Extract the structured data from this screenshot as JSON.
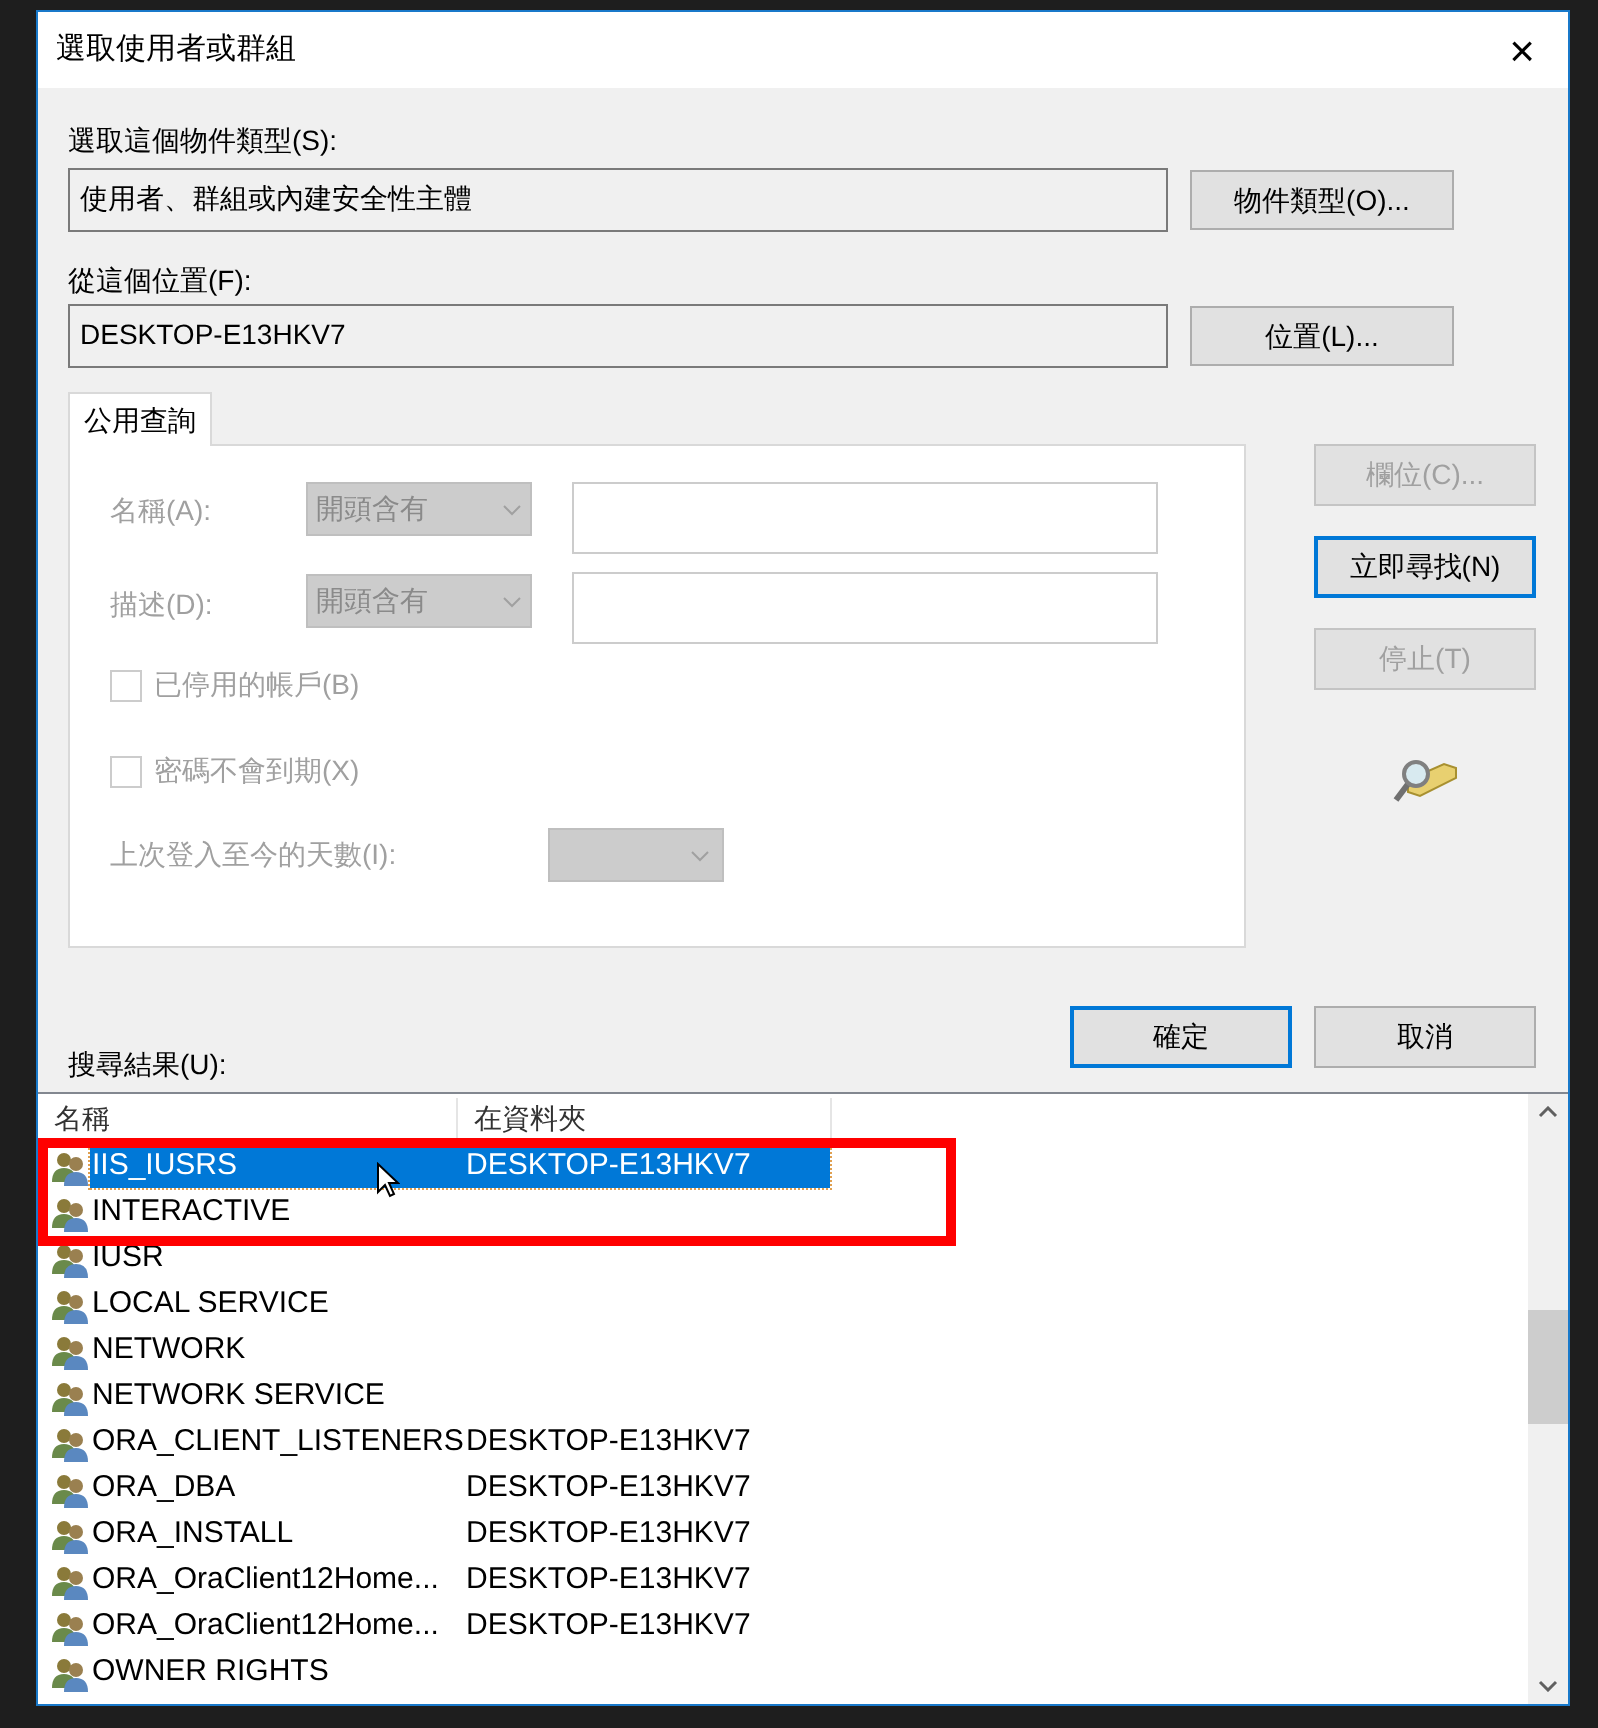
{
  "window": {
    "title": "選取使用者或群組",
    "close": "×"
  },
  "object_type": {
    "label": "選取這個物件類型(S):",
    "value": "使用者、群組或內建安全性主體",
    "button": "物件類型(O)..."
  },
  "location": {
    "label": "從這個位置(F):",
    "value": "DESKTOP-E13HKV7",
    "button": "位置(L)..."
  },
  "tabs": [
    {
      "label": "公用查詢",
      "selected": true
    }
  ],
  "query": {
    "name_label": "名稱(A):",
    "name_mode": "開頭含有",
    "description_label": "描述(D):",
    "description_mode": "開頭含有",
    "checkboxes": [
      {
        "label": "已停用的帳戶(B)",
        "checked": false,
        "disabled": true
      },
      {
        "label": "密碼不會到期(X)",
        "checked": false,
        "disabled": true
      }
    ],
    "days_label": "上次登入至今的天數(I):"
  },
  "side_buttons": [
    {
      "label": "欄位(C)...",
      "disabled": true,
      "default": false
    },
    {
      "label": "立即尋找(N)",
      "disabled": false,
      "default": true
    },
    {
      "label": "停止(T)",
      "disabled": true,
      "default": false
    }
  ],
  "results_label": "搜尋結果(U):",
  "dialog_buttons": [
    {
      "label": "確定",
      "default": true
    },
    {
      "label": "取消",
      "default": false
    }
  ],
  "results": {
    "columns": [
      "名稱",
      "在資料夾"
    ],
    "rows": [
      {
        "name": "IIS_IUSRS",
        "folder": "DESKTOP-E13HKV7",
        "selected": true
      },
      {
        "name": "INTERACTIVE",
        "selected": false
      },
      {
        "name": "IUSR",
        "selected": false
      },
      {
        "name": "LOCAL SERVICE",
        "selected": false
      },
      {
        "name": "NETWORK",
        "selected": false
      },
      {
        "name": "NETWORK SERVICE",
        "selected": false
      },
      {
        "name": "ORA_CLIENT_LISTENERS",
        "folder": "DESKTOP-E13HKV7",
        "selected": false
      },
      {
        "name": "ORA_DBA",
        "folder": "DESKTOP-E13HKV7",
        "selected": false
      },
      {
        "name": "ORA_INSTALL",
        "folder": "DESKTOP-E13HKV7",
        "selected": false
      },
      {
        "name": "ORA_OraClient12Home...",
        "folder": "DESKTOP-E13HKV7",
        "selected": false
      },
      {
        "name": "ORA_OraClient12Home...",
        "folder": "DESKTOP-E13HKV7",
        "selected": false
      },
      {
        "name": "OWNER RIGHTS",
        "selected": false
      }
    ]
  }
}
